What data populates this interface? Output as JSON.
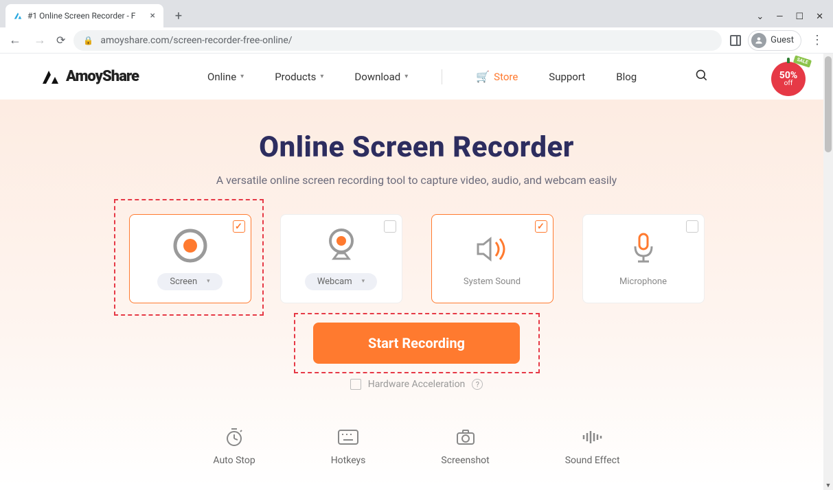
{
  "browser": {
    "tab_title": "#1 Online Screen Recorder - F",
    "url_host": "amoyshare.com",
    "url_path": "/screen-recorder-free-online/",
    "guest_label": "Guest"
  },
  "header": {
    "brand": "AmoyShare",
    "nav": {
      "online": "Online",
      "products": "Products",
      "download": "Download",
      "store": "Store",
      "support": "Support",
      "blog": "Blog"
    },
    "sale": {
      "pct": "50%",
      "off": "off",
      "tag": "SALE"
    }
  },
  "hero": {
    "title": "Online Screen Recorder",
    "subtitle": "A versatile online screen recording tool to capture video, audio, and webcam easily"
  },
  "cards": {
    "screen": {
      "label": "Screen"
    },
    "webcam": {
      "label": "Webcam"
    },
    "system_sound": {
      "label": "System Sound"
    },
    "microphone": {
      "label": "Microphone"
    }
  },
  "actions": {
    "start": "Start Recording",
    "hw_accel": "Hardware Acceleration"
  },
  "features": {
    "auto_stop": "Auto Stop",
    "hotkeys": "Hotkeys",
    "screenshot": "Screenshot",
    "sound_effect": "Sound Effect"
  }
}
